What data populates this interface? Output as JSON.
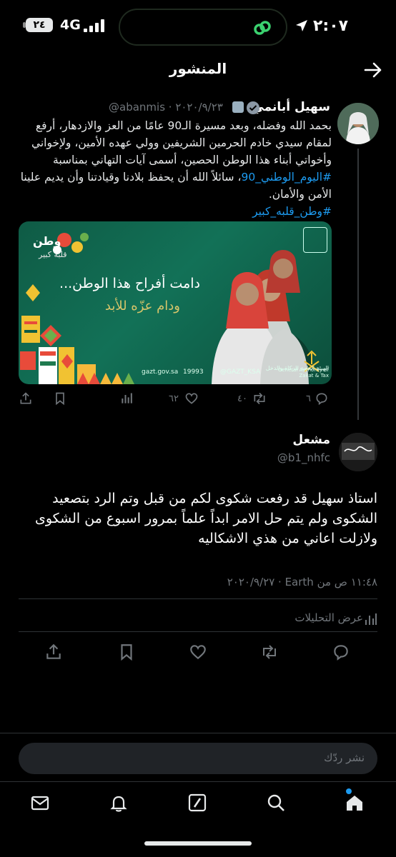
{
  "status_bar": {
    "time": "٢:٠٧",
    "network": "4G",
    "battery": "٢٤"
  },
  "header": {
    "title": "المنشور"
  },
  "quoted_tweet": {
    "author_name": "سهيل أبانمي",
    "handle_date": "@abanmis · ٢٠٢٠/٩/٢٣",
    "body": "بحمد الله وفضله، وبعد مسيرة الـ90 عامًا من العز والازدهار، أرفع لمقام سيدي خادم الحرمين الشريفين وولي عهده الأمين، ولإخواني وأخواتي أبناء هذا الوطن الحصين، أسمى آيات التهاني بمناسبة",
    "hashtag_inline": "#اليوم_الوطني_90",
    "body_end": "، سائلاً الله أن يحفظ بلادنا وقيادتنا وأن يديم علينا الأمن والأمان.",
    "hashtag_end": "#وطن_قلبه_كبير",
    "media": {
      "line1": "دامت أفراح هذا الوطن...",
      "line2": "ودام عزّه للأبد",
      "brand": "وطن",
      "brand_sub": "قلبه كبير",
      "site": "gazt.gov.sa",
      "phone": "19993",
      "social": "@GAZT_KSA",
      "authority_ar": "الهيئة العامة للزكاة والدخل",
      "authority_en": "General Authority of Zakat & Tax"
    },
    "actions": {
      "replies": "٦",
      "retweets": "٤٠",
      "likes": "٦٢"
    }
  },
  "reply": {
    "author_name": "مشعل",
    "handle": "@b1_nhfc",
    "body": "استاذ سهيل قد رفعت شكوى لكم من قبل وتم الرد بتصعيد الشكوى ولم يتم حل الامر ابداً علماً بمرور اسبوع من الشكوى ولازلت اعاني من هذي الاشكاليه",
    "meta": "١١:٤٨ ص من Earth · ٢٠٢٠/٩/٢٧",
    "analytics_label": "عرض التحليلات"
  },
  "composer": {
    "placeholder": "نشر ردّك"
  },
  "icons": {
    "back": "arrow-right-icon",
    "verified": "verified-badge-icon",
    "home": "home-icon",
    "search": "search-icon",
    "compose": "compose-icon",
    "notifications": "bell-icon",
    "messages": "mail-icon"
  },
  "colors": {
    "accent": "#1d9bf0",
    "background": "#000000",
    "muted": "#71767b"
  }
}
